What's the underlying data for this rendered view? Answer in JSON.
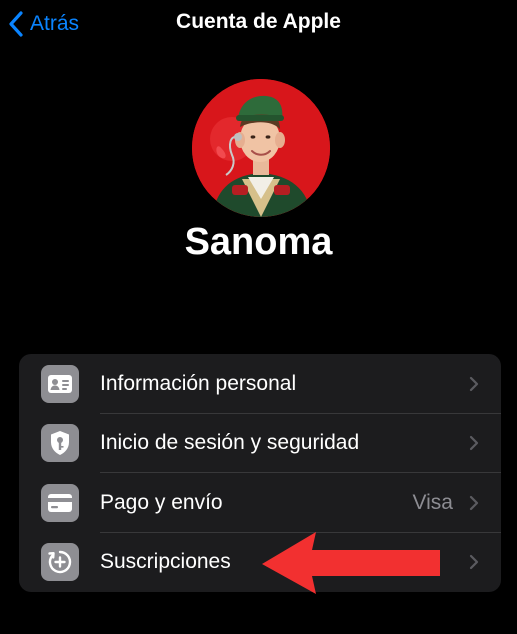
{
  "nav": {
    "back_label": "Atrás",
    "title": "Cuenta de Apple"
  },
  "profile": {
    "name": "Sanoma"
  },
  "menu": {
    "items": [
      {
        "label": "Información personal",
        "value": "",
        "icon": "person-card-icon"
      },
      {
        "label": "Inicio de sesión y seguridad",
        "value": "",
        "icon": "shield-key-icon"
      },
      {
        "label": "Pago y envío",
        "value": "Visa",
        "icon": "credit-card-icon"
      },
      {
        "label": "Suscripciones",
        "value": "",
        "icon": "subscriptions-icon"
      }
    ]
  },
  "colors": {
    "accent": "#0a84ff",
    "background": "#000000",
    "group_background": "#1c1c1e",
    "icon_tile": "#8e8e93",
    "annotation_arrow": "#f23030"
  }
}
